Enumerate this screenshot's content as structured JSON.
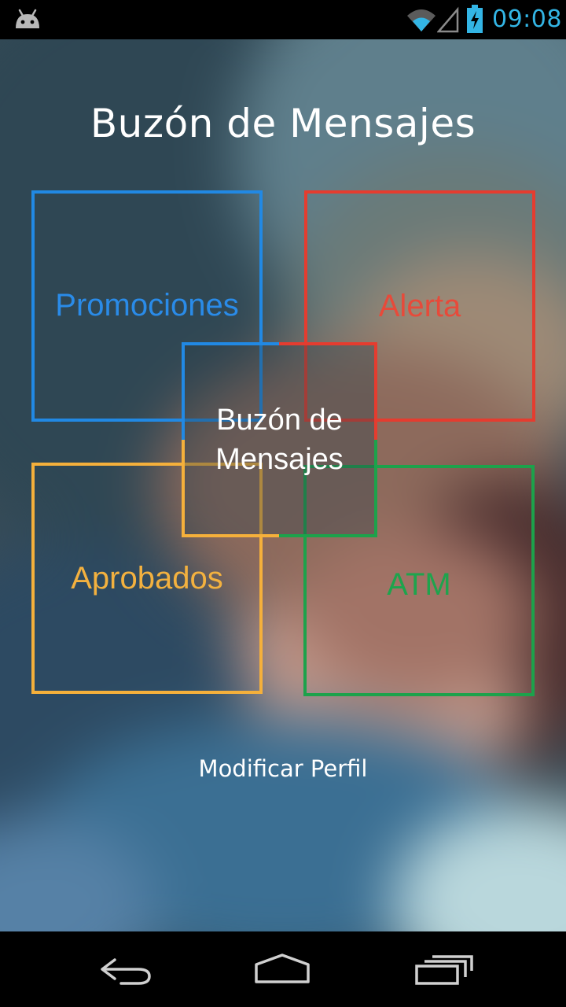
{
  "status_bar": {
    "time": "09:08",
    "icons": [
      "android-icon",
      "wifi-icon",
      "signal-icon",
      "battery-charging-icon"
    ],
    "accent_color": "#33b5e5"
  },
  "page": {
    "title": "Buzón de Mensajes"
  },
  "tiles": {
    "promociones": {
      "label": "Promociones",
      "color": "#2189e4"
    },
    "alerta": {
      "label": "Alerta",
      "color": "#e53c2f"
    },
    "center": {
      "label_line1": "Buzón de",
      "label_line2": "Mensajes",
      "color": "#ffffff"
    },
    "aprobados": {
      "label": "Aprobados",
      "color": "#f5b03b"
    },
    "atm": {
      "label": "ATM",
      "color": "#1ca24b"
    }
  },
  "footer": {
    "profile_link": "Modificar Perfil"
  },
  "nav_bar": {
    "icons": [
      "back-icon",
      "home-icon",
      "recents-icon"
    ]
  }
}
